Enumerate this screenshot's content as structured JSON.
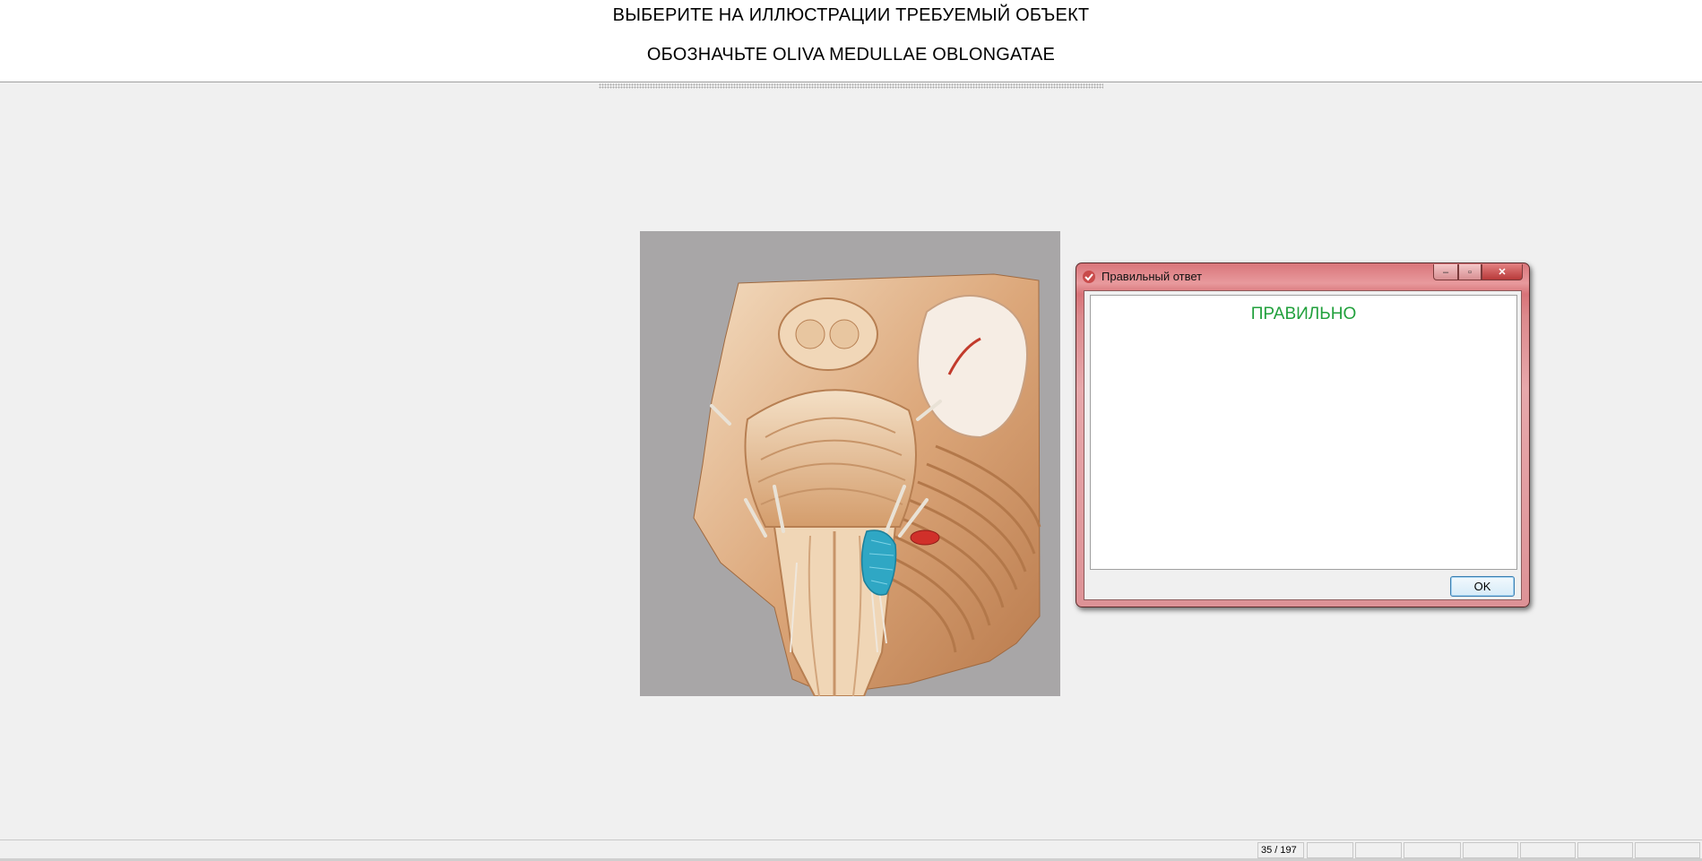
{
  "header": {
    "instruction": "ВЫБЕРИТЕ НА ИЛЛЮСТРАЦИИ ТРЕБУЕМЫЙ ОБЪЕКТ",
    "task": "ОБОЗНАЧЬТЕ OLIVA MEDULLAE OBLONGATAE"
  },
  "illustration": {
    "subject": "brainstem-anatomy",
    "background_color": "#a8a6a7",
    "highlight_color": "#2fa7c4",
    "marker_color": "#d0302a"
  },
  "dialog": {
    "title": "Правильный ответ",
    "result": "ПРАВИЛЬНО",
    "result_color": "#21a03c",
    "ok_label": "OK",
    "minimize_icon": "minimize-icon",
    "maximize_icon": "maximize-icon",
    "close_icon": "close-icon"
  },
  "statusbar": {
    "progress": "35 / 197"
  }
}
